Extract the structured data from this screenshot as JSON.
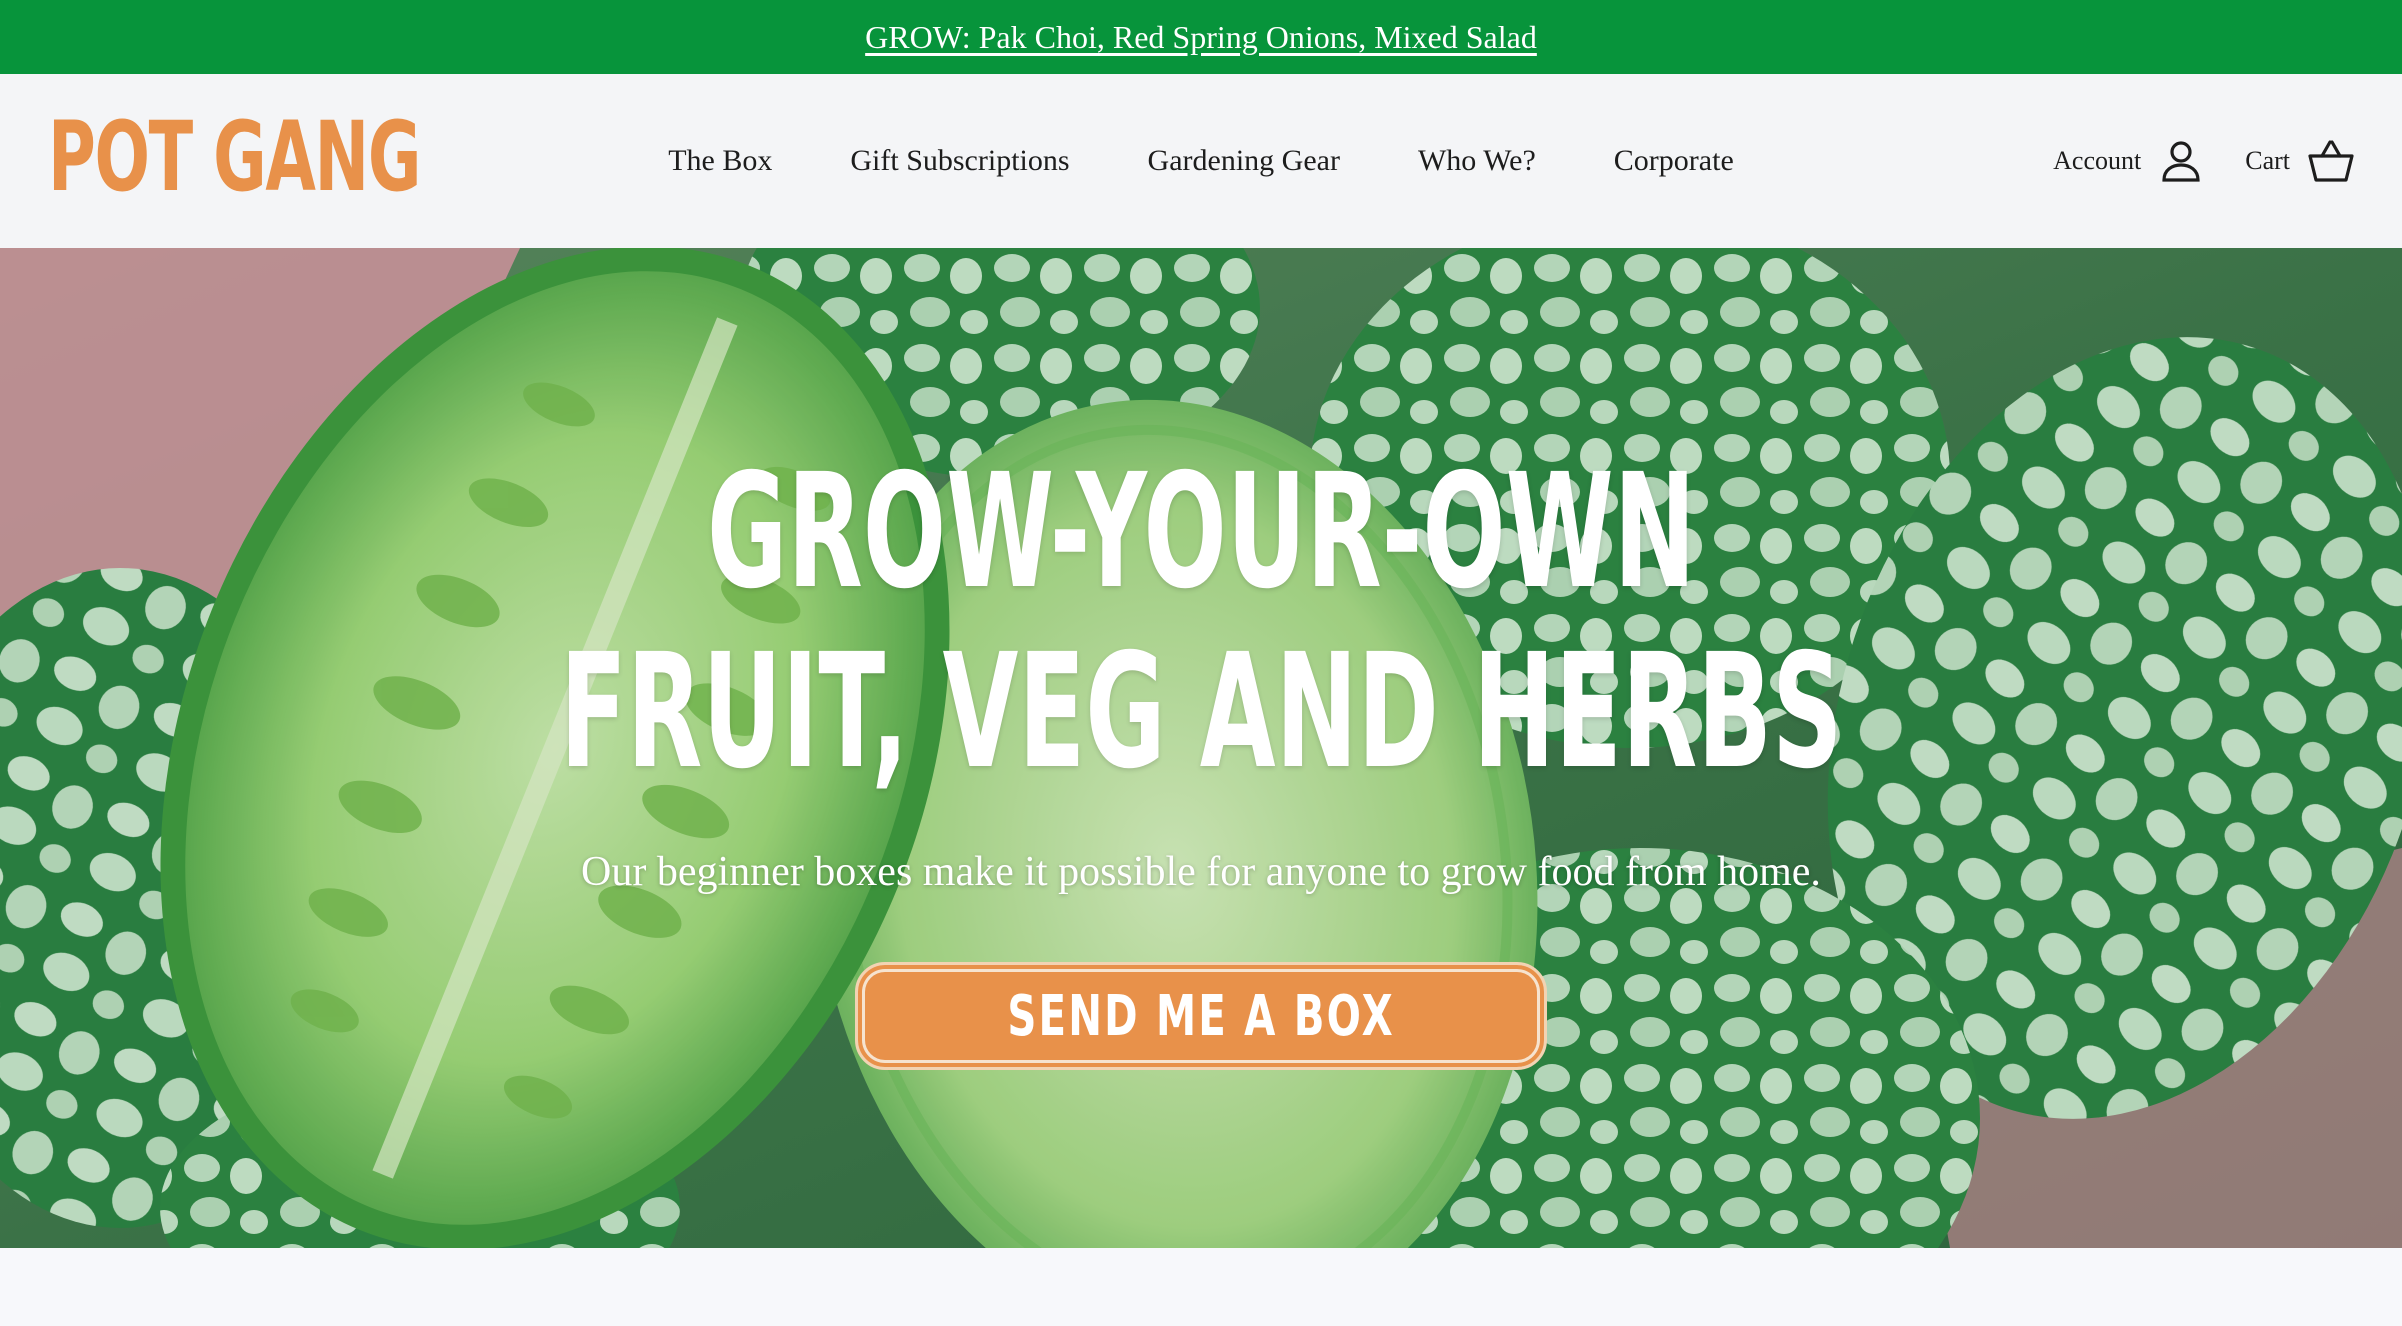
{
  "announcement": {
    "text": "GROW: Pak Choi, Red Spring Onions, Mixed Salad"
  },
  "header": {
    "logo_text": "POT GANG",
    "nav": [
      {
        "label": "The Box"
      },
      {
        "label": "Gift Subscriptions"
      },
      {
        "label": "Gardening Gear"
      },
      {
        "label": "Who We?"
      },
      {
        "label": "Corporate"
      }
    ],
    "account_label": "Account",
    "cart_label": "Cart",
    "account_icon": "user-icon",
    "cart_icon": "basket-icon"
  },
  "hero": {
    "title_line1": "GROW-YOUR-OWN",
    "title_line2": "FRUIT, VEG AND HERBS",
    "subtitle": "Our beginner boxes make it possible for anyone to grow food from home.",
    "cta_label": "SEND ME A BOX"
  },
  "colors": {
    "announcement_bg": "#07943b",
    "brand_orange": "#e8914a",
    "header_bg": "#f4f5f7",
    "text_dark": "#1d1d1d"
  }
}
